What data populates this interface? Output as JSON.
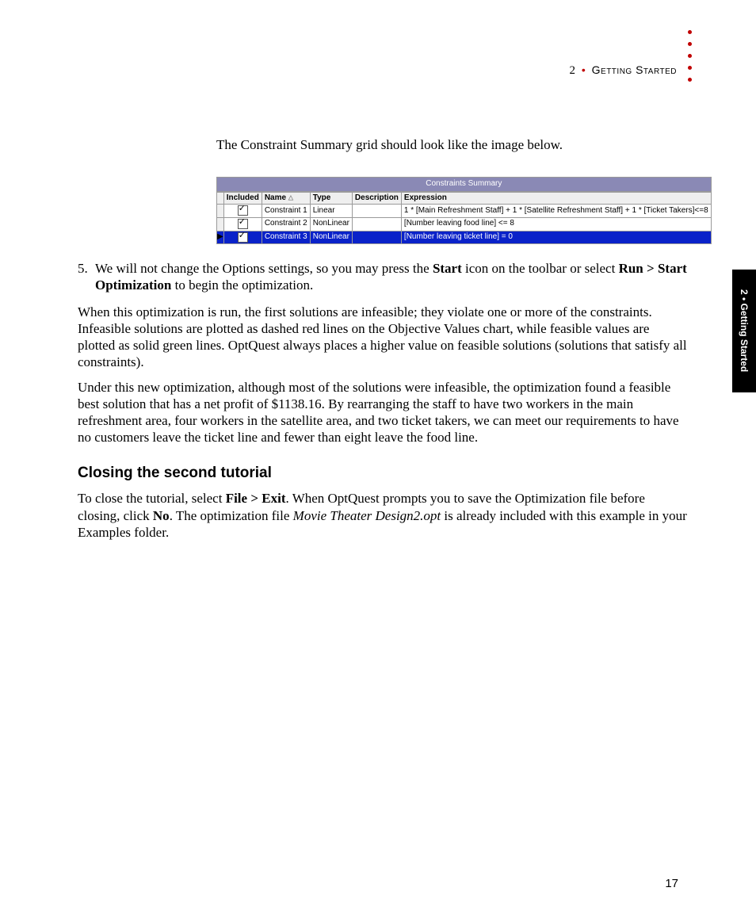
{
  "header": {
    "chapter_num": "2",
    "title": "Getting Started"
  },
  "side_tab": "2 • Getting Started",
  "page_number": "17",
  "intro_text": "The Constraint Summary grid should look like the image below.",
  "grid": {
    "title": "Constraints Summary",
    "columns": {
      "included": "Included",
      "name": "Name",
      "type": "Type",
      "description": "Description",
      "expression": "Expression"
    },
    "rows": [
      {
        "included": true,
        "name": "Constraint 1",
        "type": "Linear",
        "description": "",
        "expression": "1 * [Main Refreshment Staff] + 1 * [Satellite Refreshment Staff] + 1 * [Ticket Takers]<=8",
        "selected": false
      },
      {
        "included": true,
        "name": "Constraint 2",
        "type": "NonLinear",
        "description": "",
        "expression": "[Number leaving food line]  <= 8",
        "selected": false
      },
      {
        "included": true,
        "name": "Constraint 3",
        "type": "NonLinear",
        "description": "",
        "expression": "[Number leaving ticket line] = 0",
        "selected": true
      }
    ]
  },
  "step5": {
    "num": "5.",
    "t1": "We will not change the Options settings, so you may press the ",
    "b1": "Start",
    "t2": " icon on the tool­bar or select ",
    "b2": "Run > Start Optimization",
    "t3": " to begin the optimization."
  },
  "para1": "When this optimization is run, the first solutions are infeasible; they violate one or more of the constraints. Infeasible solutions are plotted as dashed red lines on the Objective Values chart, while feasible values are plotted as solid green lines. OptQuest always places a higher value on feasible solutions (solutions that satisfy all constraints).",
  "para2": "Under this new optimization, although most of the solutions were infeasible, the optimiza­tion found a feasible best solution that has a net profit of $1138.16. By rearranging the staff to have two workers in the main refreshment area, four workers in the satellite area, and two ticket takers, we can meet our requirements to have no customers leave the ticket line and fewer than eight leave the food line.",
  "section_heading": "Closing the second tutorial",
  "closing": {
    "t1": "To close the tutorial, select ",
    "b1": "File > Exit",
    "t2": ". When OptQuest prompts you to save the Optimi­zation file before closing, click ",
    "b2": "No",
    "t3": ". The optimization file ",
    "i1": "Movie Theater Design2.opt",
    "t4": " is already included with this example in your Examples folder."
  }
}
